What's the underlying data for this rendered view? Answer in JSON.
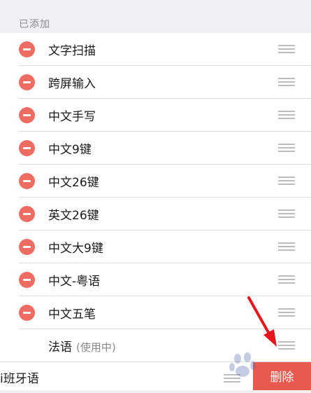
{
  "section_header": "已添加",
  "added_items": [
    {
      "label": "文字扫描"
    },
    {
      "label": "跨屏输入"
    },
    {
      "label": "中文手写"
    },
    {
      "label": "中文9键"
    },
    {
      "label": "中文26键"
    },
    {
      "label": "英文26键"
    },
    {
      "label": "中文大9键"
    },
    {
      "label": "中文-粤语"
    },
    {
      "label": "中文五笔"
    }
  ],
  "active_item": {
    "label": "法语",
    "status": "(使用中)"
  },
  "swiped_item": {
    "label": "i班牙语",
    "delete_label": "删除"
  },
  "colors": {
    "remove_red": "#ee6c61",
    "delete_red": "#e85a4f",
    "arrow_red": "#e5161c",
    "background": "#f1f1f3"
  },
  "icons": {
    "remove": "minus-circle-icon",
    "reorder": "drag-handle-icon"
  }
}
